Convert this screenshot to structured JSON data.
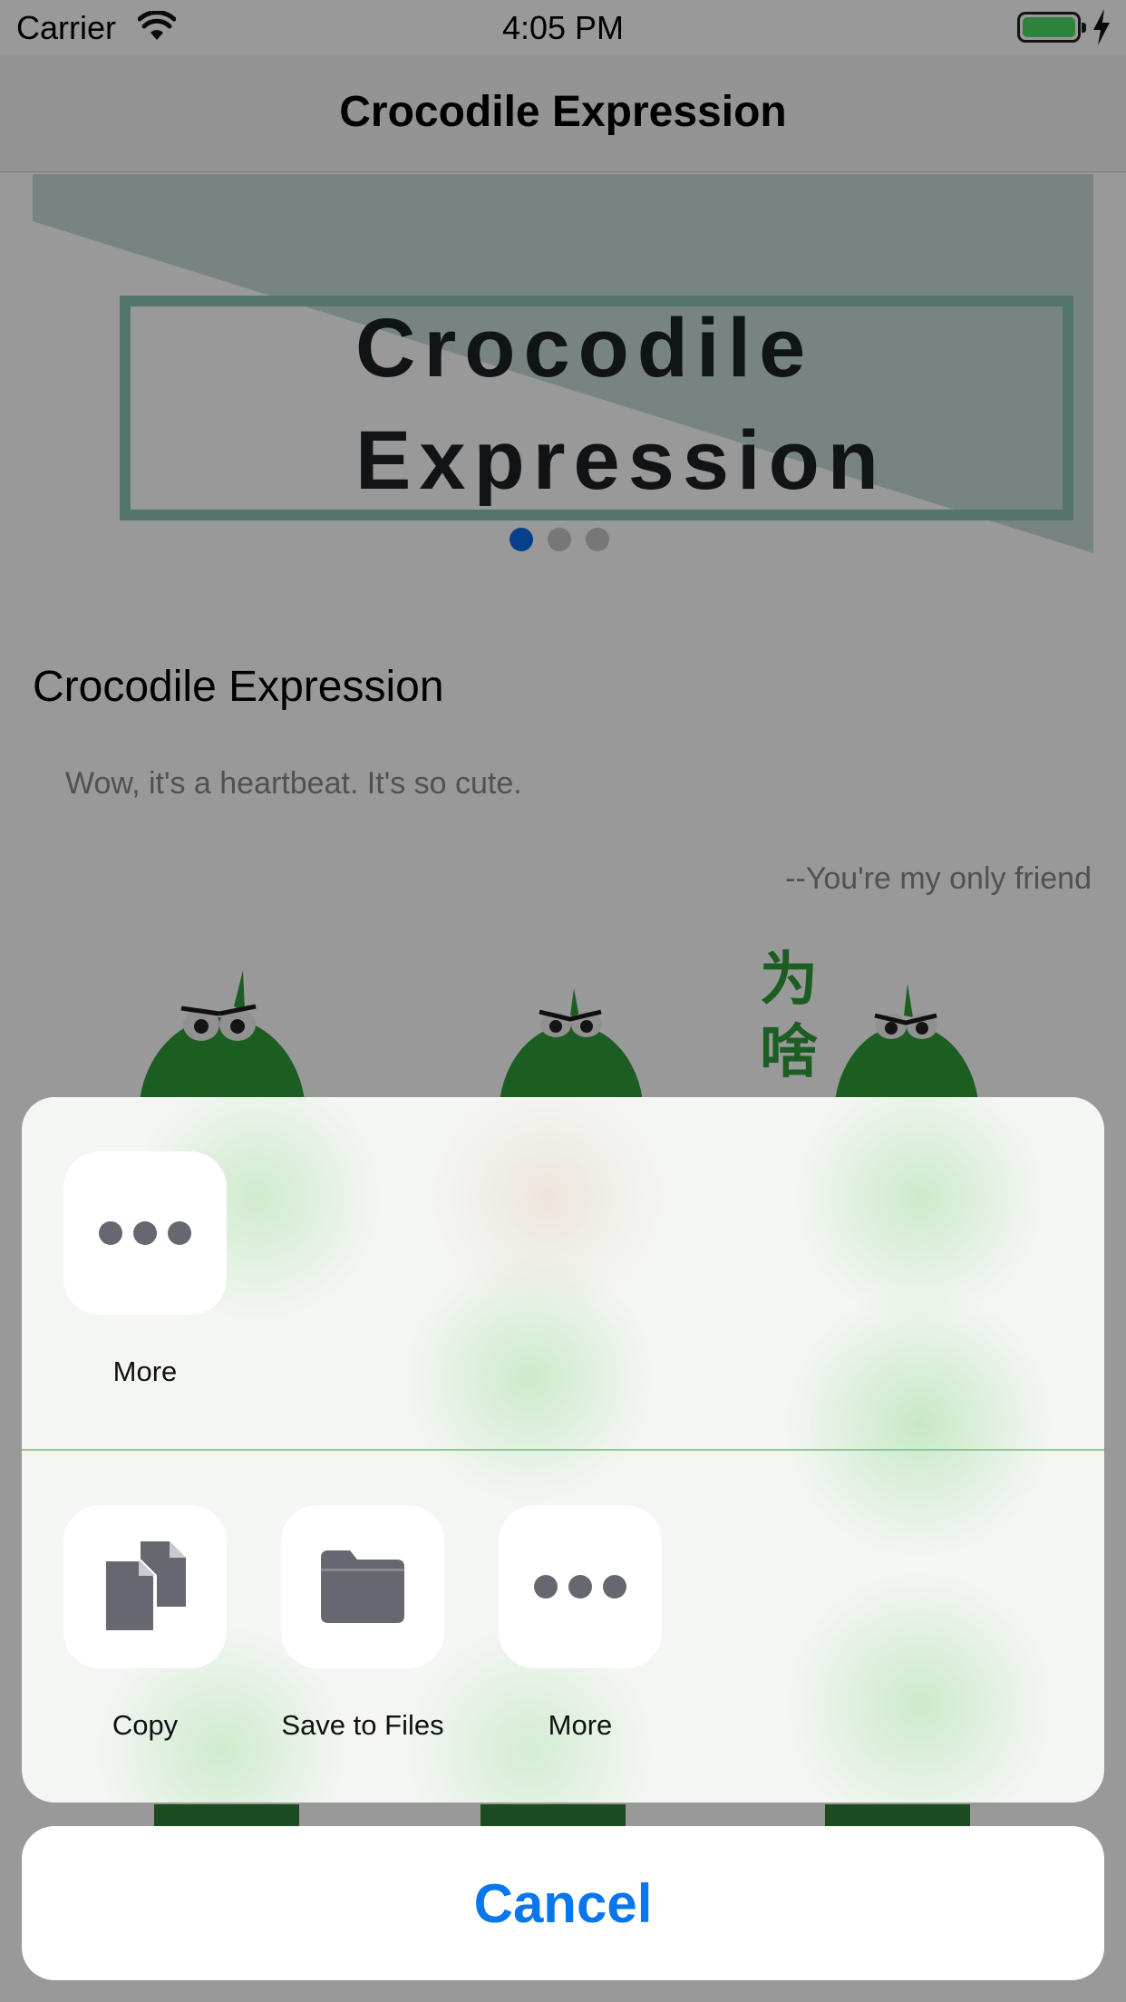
{
  "status_bar": {
    "carrier": "Carrier",
    "time": "4:05 PM",
    "battery_color": "#4cd964"
  },
  "nav": {
    "title": "Crocodile Expression"
  },
  "banner": {
    "line1": "Crocodile",
    "line2": "Expression",
    "page_count": 3,
    "active_page": 1
  },
  "content": {
    "section_title": "Crocodile Expression",
    "quote": "Wow, it's a heartbeat. It's so cute.",
    "attribution": "--You're my only friend",
    "sticker_caption_chars": [
      "为",
      "啥"
    ]
  },
  "share_sheet": {
    "top_row": [
      {
        "label": "More",
        "icon": "more-icon"
      }
    ],
    "action_row": [
      {
        "label": "Copy",
        "icon": "copy-icon"
      },
      {
        "label": "Save to Files",
        "icon": "folder-icon"
      },
      {
        "label": "More",
        "icon": "more-icon"
      }
    ],
    "cancel_label": "Cancel"
  },
  "colors": {
    "accent": "#0a76ee",
    "page_dot_active": "#0a6bea",
    "crocodile_green": "#2f9b3a"
  }
}
